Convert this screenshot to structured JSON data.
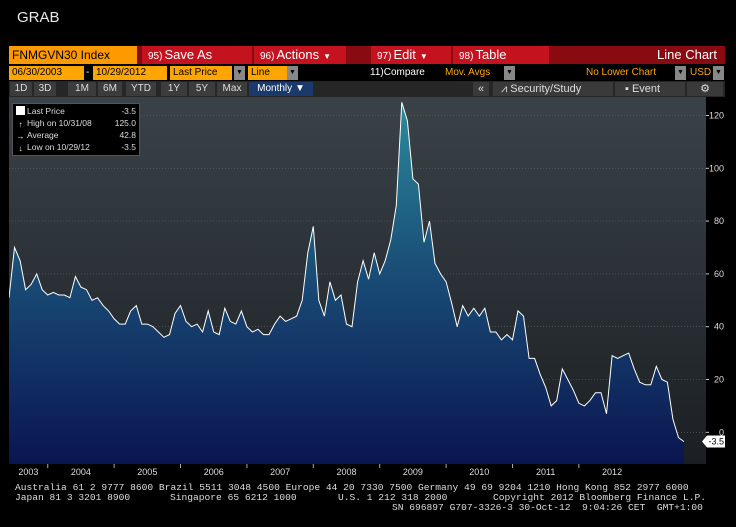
{
  "window": {
    "title": "GRAB"
  },
  "toolbar": {
    "ticker": "FNMGVN30 Index",
    "save": {
      "num": "95)",
      "label": "Save As"
    },
    "actions": {
      "num": "96)",
      "label": "Actions"
    },
    "edit": {
      "num": "97)",
      "label": "Edit"
    },
    "table": {
      "num": "98)",
      "label": "Table"
    },
    "view_title": "Line Chart"
  },
  "params": {
    "start_date": "06/30/2003",
    "end_date": "10/29/2012",
    "field": "Last Price",
    "style": "Line",
    "compare_num": "11)",
    "compare_label": "Compare",
    "mov_avgs": "Mov. Avgs",
    "lower_chart": "No Lower Chart",
    "currency": "USD"
  },
  "tabs": {
    "periods": [
      "1D",
      "3D",
      "1M",
      "6M",
      "YTD",
      "1Y",
      "5Y",
      "Max"
    ],
    "frequency": "Monthly",
    "collapse": "«",
    "security_study": "Security/Study",
    "event": "Event",
    "settings": "⚙"
  },
  "legend": {
    "last_price": {
      "label": "Last Price",
      "value": "-3.5"
    },
    "high": {
      "label": "High on 10/31/08",
      "value": "125.0"
    },
    "average": {
      "label": "Average",
      "value": "42.8"
    },
    "low": {
      "label": "Low on 10/29/12",
      "value": "-3.5"
    }
  },
  "footer": {
    "line1": "Australia 61 2 9777 8600 Brazil 5511 3048 4500 Europe 44 20 7330 7500 Germany 49 69 9204 1210 Hong Kong 852 2977 6000",
    "line2a": "Japan 81 3 3201 8900",
    "line2b": "Singapore 65 6212 1000",
    "line2c": "U.S. 1 212 318 2000",
    "line2d": "Copyright 2012 Bloomberg Finance L.P.",
    "line3": "SN 696897 G707-3326-3 30-Oct-12  9:04:26 CET  GMT+1:00"
  },
  "colors": {
    "title_red": "#c4121f",
    "amber": "#ffa500",
    "area_top": "#2a7a8e",
    "area_bottom": "#0a1550",
    "line": "#ffffff"
  },
  "chart_data": {
    "type": "area",
    "frequency": "monthly",
    "y_ticks": [
      0,
      20,
      40,
      60,
      80,
      100,
      120
    ],
    "ylim": [
      -12,
      127
    ],
    "x_labels": [
      "2003",
      "2004",
      "2005",
      "2006",
      "2007",
      "2008",
      "2009",
      "2010",
      "2011",
      "2012"
    ],
    "last_value_label": "-3.5",
    "grid": true,
    "series": [
      {
        "values": [
          51,
          70,
          65,
          54,
          56,
          60,
          54,
          52,
          53,
          52,
          52,
          51,
          59,
          55,
          54,
          50,
          51,
          48,
          46,
          43,
          41,
          41,
          46,
          48,
          41,
          41,
          40,
          38,
          36,
          37,
          45,
          48,
          42,
          40,
          41,
          38,
          46,
          38,
          37,
          47,
          42,
          41,
          46,
          40,
          38,
          39,
          37,
          37,
          41,
          44,
          42,
          43,
          44,
          50,
          68,
          78,
          50,
          44,
          57,
          50,
          52,
          41,
          40,
          57,
          65,
          58,
          68,
          60,
          65,
          73,
          86,
          125,
          118,
          96,
          94,
          72,
          80,
          64,
          60,
          57,
          49,
          40,
          48,
          44,
          47,
          44,
          47,
          38,
          38,
          35,
          37,
          35,
          46,
          44,
          28,
          28,
          22,
          17,
          10,
          12,
          24,
          20,
          16,
          11,
          10,
          12,
          15,
          15,
          7,
          29,
          28,
          29,
          30,
          24,
          19,
          18,
          18,
          25,
          20,
          19,
          5,
          -2,
          -3.5
        ]
      }
    ]
  }
}
